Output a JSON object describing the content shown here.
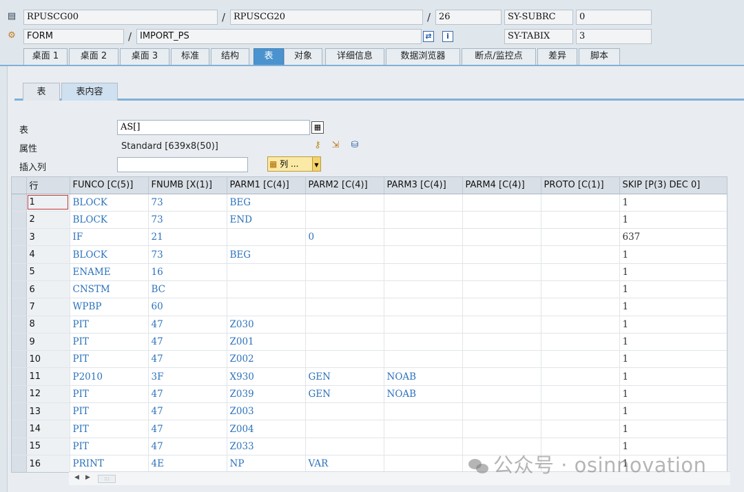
{
  "header": {
    "row1": {
      "program1": "RPUSCG00",
      "program2": "RPUSCG20",
      "line": "26",
      "sysvar": "SY-SUBRC",
      "sysval": "0"
    },
    "row2": {
      "type": "FORM",
      "name": "IMPORT_PS",
      "sysvar": "SY-TABIX",
      "sysval": "3"
    },
    "separator": "/"
  },
  "tabs": [
    "桌面 1",
    "桌面 2",
    "桌面 3",
    "标准",
    "结构",
    "表",
    "对象",
    "详细信息",
    "数据浏览器",
    "断点/监控点",
    "差异",
    "脚本"
  ],
  "active_tab": "表",
  "subtabs": [
    "表",
    "表内容"
  ],
  "active_subtab": "表内容",
  "form": {
    "table_label": "表",
    "table_value": "AS[]",
    "attr_label": "属性",
    "attr_value": "Standard [639x8(50)]",
    "insert_label": "插入列",
    "insert_value": "",
    "columns_button": "列 ..."
  },
  "grid": {
    "columns": [
      "行",
      "FUNCO [C(5)]",
      "FNUMB [X(1)]",
      "PARM1 [C(4)]",
      "PARM2 [C(4)]",
      "PARM3 [C(4)]",
      "PARM4 [C(4)]",
      "PROTO [C(1)]",
      "SKIP [P(3) DEC 0]"
    ],
    "rows": [
      [
        "1",
        "BLOCK",
        "73",
        "BEG",
        "",
        "",
        "",
        "",
        "1"
      ],
      [
        "2",
        "BLOCK",
        "73",
        "END",
        "",
        "",
        "",
        "",
        "1"
      ],
      [
        "3",
        "IF",
        "21",
        "",
        "0",
        "",
        "",
        "",
        "637"
      ],
      [
        "4",
        "BLOCK",
        "73",
        "BEG",
        "",
        "",
        "",
        "",
        "1"
      ],
      [
        "5",
        "ENAME",
        "16",
        "",
        "",
        "",
        "",
        "",
        "1"
      ],
      [
        "6",
        "CNSTM",
        "BC",
        "",
        "",
        "",
        "",
        "",
        "1"
      ],
      [
        "7",
        "WPBP",
        "60",
        "",
        "",
        "",
        "",
        "",
        "1"
      ],
      [
        "8",
        "PIT",
        "47",
        "Z030",
        "",
        "",
        "",
        "",
        "1"
      ],
      [
        "9",
        "PIT",
        "47",
        "Z001",
        "",
        "",
        "",
        "",
        "1"
      ],
      [
        "10",
        "PIT",
        "47",
        "Z002",
        "",
        "",
        "",
        "",
        "1"
      ],
      [
        "11",
        "P2010",
        "3F",
        "X930",
        "GEN",
        "NOAB",
        "",
        "",
        "1"
      ],
      [
        "12",
        "PIT",
        "47",
        "Z039",
        "GEN",
        "NOAB",
        "",
        "",
        "1"
      ],
      [
        "13",
        "PIT",
        "47",
        "Z003",
        "",
        "",
        "",
        "",
        "1"
      ],
      [
        "14",
        "PIT",
        "47",
        "Z004",
        "",
        "",
        "",
        "",
        "1"
      ],
      [
        "15",
        "PIT",
        "47",
        "Z033",
        "",
        "",
        "",
        "",
        "1"
      ],
      [
        "16",
        "PRINT",
        "4E",
        "NP",
        "VAR",
        "",
        "",
        "",
        "1"
      ]
    ]
  },
  "watermark": "公众号 · osinnovation"
}
